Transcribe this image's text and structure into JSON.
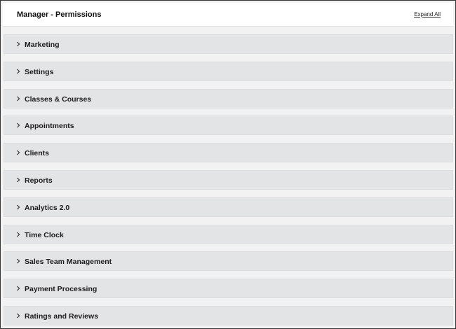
{
  "header": {
    "title": "Manager - Permissions",
    "expand_all_label": "Expand All"
  },
  "sections": [
    {
      "label": "Marketing",
      "icon": "chevron-right-icon"
    },
    {
      "label": "Settings",
      "icon": "chevron-right-icon"
    },
    {
      "label": "Classes & Courses",
      "icon": "chevron-right-icon"
    },
    {
      "label": "Appointments",
      "icon": "chevron-right-icon"
    },
    {
      "label": "Clients",
      "icon": "chevron-right-icon"
    },
    {
      "label": "Reports",
      "icon": "chevron-right-icon"
    },
    {
      "label": "Analytics 2.0",
      "icon": "chevron-right-icon"
    },
    {
      "label": "Time Clock",
      "icon": "chevron-right-icon"
    },
    {
      "label": "Sales Team Management",
      "icon": "chevron-right-icon"
    },
    {
      "label": "Payment Processing",
      "icon": "chevron-right-icon"
    },
    {
      "label": "Ratings and Reviews",
      "icon": "chevron-right-icon"
    }
  ],
  "colors": {
    "row_background": "#e3e4e6",
    "page_background": "#f2f2f2",
    "text": "#1c1c1c"
  }
}
